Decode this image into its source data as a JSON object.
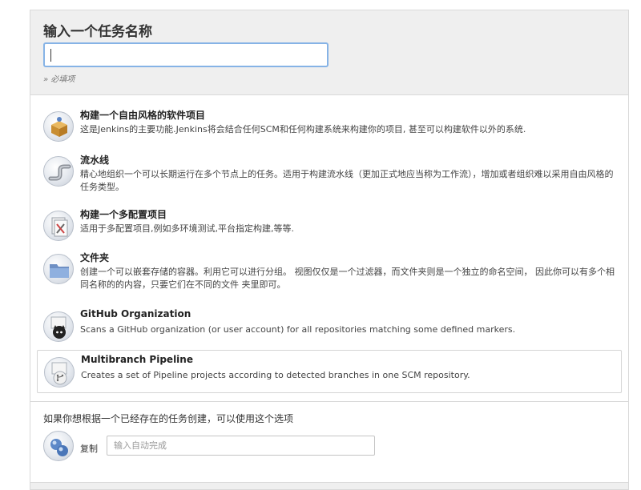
{
  "item_name": {
    "title": "输入一个任务名称",
    "value": "",
    "required_hint": "» 必填项"
  },
  "types": [
    {
      "name": "构建一个自由风格的软件项目",
      "description": "这是Jenkins的主要功能.Jenkins将会结合任何SCM和任何构建系统来构建你的项目, 甚至可以构建软件以外的系统.",
      "icon": "freestyle-box-icon"
    },
    {
      "name": "流水线",
      "description": "精心地组织一个可以长期运行在多个节点上的任务。适用于构建流水线（更加正式地应当称为工作流），增加或者组织难以采用自由风格的任务类型。",
      "icon": "pipeline-icon"
    },
    {
      "name": "构建一个多配置项目",
      "description": "适用于多配置项目,例如多环境测试,平台指定构建,等等.",
      "icon": "multi-config-icon"
    },
    {
      "name": "文件夹",
      "description": "创建一个可以嵌套存储的容器。利用它可以进行分组。 视图仅仅是一个过滤器，而文件夹则是一个独立的命名空间， 因此你可以有多个相同名称的的内容，只要它们在不同的文件 夹里即可。",
      "icon": "folder-icon"
    },
    {
      "name": "GitHub Organization",
      "description": "Scans a GitHub organization (or user account) for all repositories matching some defined markers.",
      "icon": "github-icon"
    },
    {
      "name": "Multibranch Pipeline",
      "description": "Creates a set of Pipeline projects according to detected branches in one SCM repository.",
      "icon": "multibranch-icon"
    }
  ],
  "copy": {
    "hint": "如果你想根据一个已经存在的任务创建，可以使用这个选项",
    "label": "复制",
    "placeholder": "输入自动完成"
  }
}
